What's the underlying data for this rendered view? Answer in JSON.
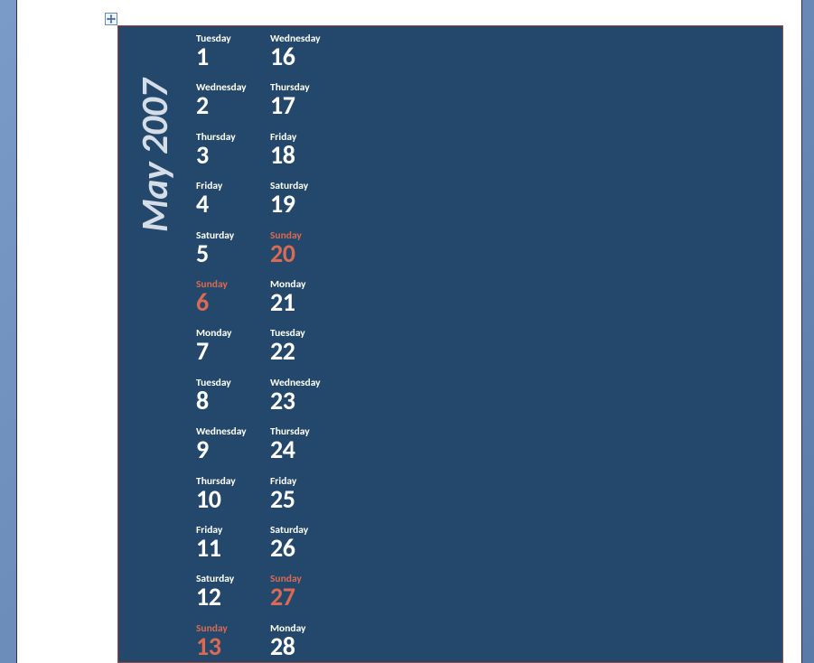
{
  "calendar": {
    "month_label": "May 2007",
    "columns": [
      [
        {
          "name": "Tuesday",
          "num": "1",
          "sunday": false
        },
        {
          "name": "Wednesday",
          "num": "2",
          "sunday": false
        },
        {
          "name": "Thursday",
          "num": "3",
          "sunday": false
        },
        {
          "name": "Friday",
          "num": "4",
          "sunday": false
        },
        {
          "name": "Saturday",
          "num": "5",
          "sunday": false
        },
        {
          "name": "Sunday",
          "num": "6",
          "sunday": true
        },
        {
          "name": "Monday",
          "num": "7",
          "sunday": false
        },
        {
          "name": "Tuesday",
          "num": "8",
          "sunday": false
        },
        {
          "name": "Wednesday",
          "num": "9",
          "sunday": false
        },
        {
          "name": "Thursday",
          "num": "10",
          "sunday": false
        },
        {
          "name": "Friday",
          "num": "11",
          "sunday": false
        },
        {
          "name": "Saturday",
          "num": "12",
          "sunday": false
        },
        {
          "name": "Sunday",
          "num": "13",
          "sunday": true
        }
      ],
      [
        {
          "name": "Wednesday",
          "num": "16",
          "sunday": false
        },
        {
          "name": "Thursday",
          "num": "17",
          "sunday": false
        },
        {
          "name": "Friday",
          "num": "18",
          "sunday": false
        },
        {
          "name": "Saturday",
          "num": "19",
          "sunday": false
        },
        {
          "name": "Sunday",
          "num": "20",
          "sunday": true
        },
        {
          "name": "Monday",
          "num": "21",
          "sunday": false
        },
        {
          "name": "Tuesday",
          "num": "22",
          "sunday": false
        },
        {
          "name": "Wednesday",
          "num": "23",
          "sunday": false
        },
        {
          "name": "Thursday",
          "num": "24",
          "sunday": false
        },
        {
          "name": "Friday",
          "num": "25",
          "sunday": false
        },
        {
          "name": "Saturday",
          "num": "26",
          "sunday": false
        },
        {
          "name": "Sunday",
          "num": "27",
          "sunday": true
        },
        {
          "name": "Monday",
          "num": "28",
          "sunday": false
        }
      ]
    ]
  }
}
